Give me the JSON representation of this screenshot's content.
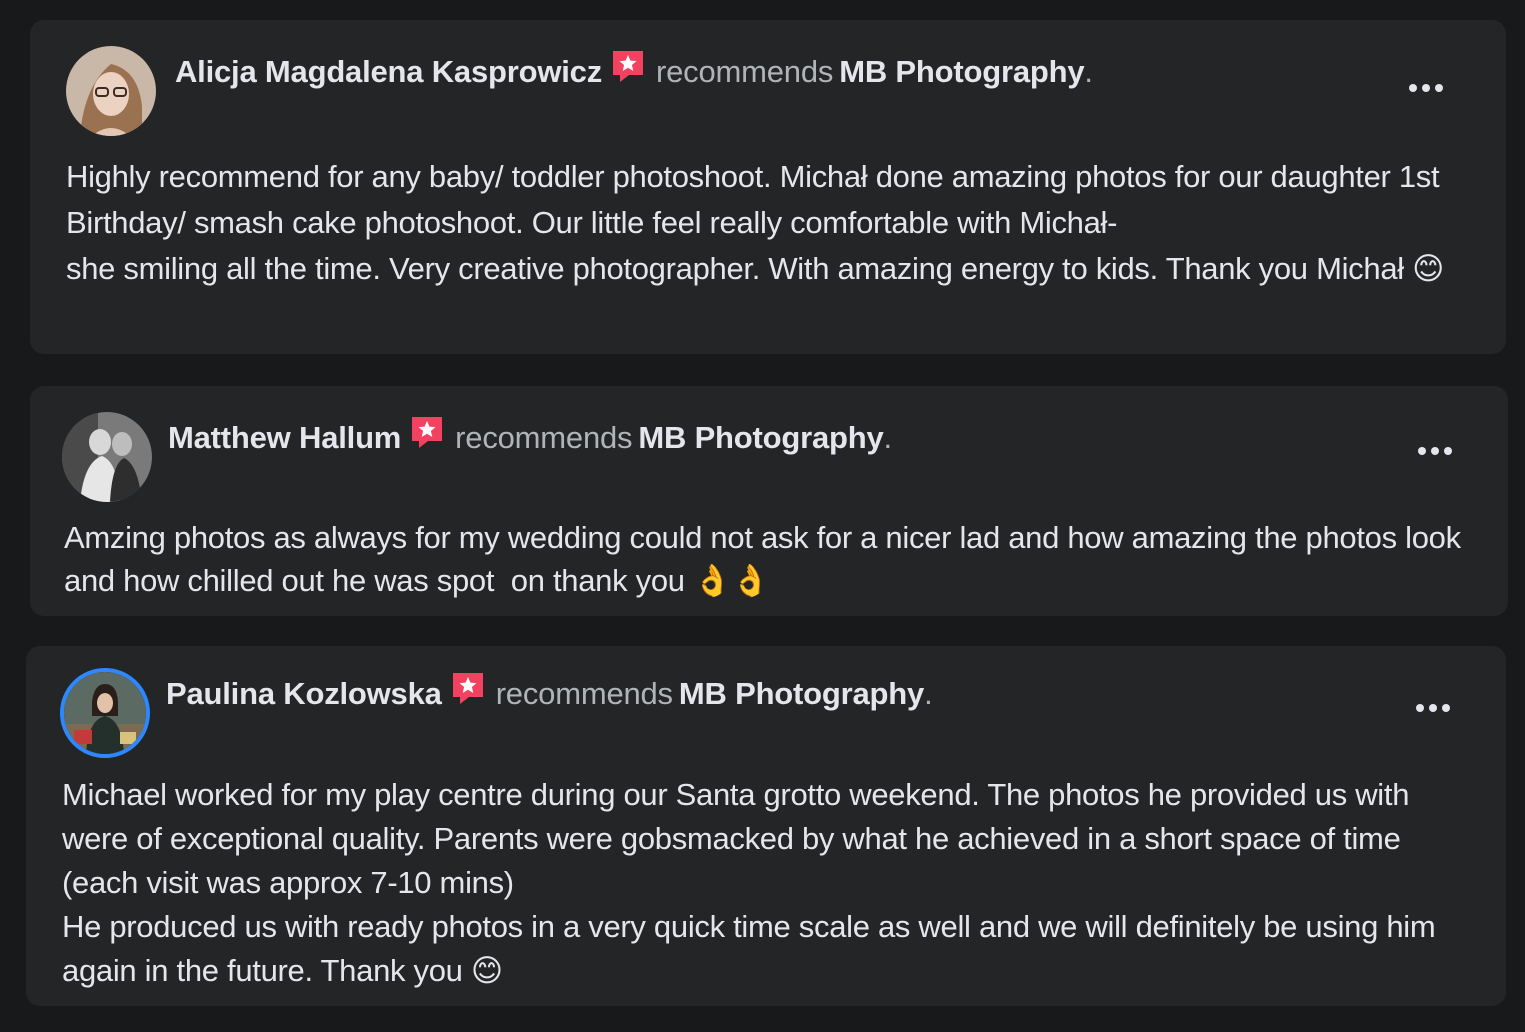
{
  "page_name": "MB Photography",
  "recommends_label": "recommends",
  "period": ".",
  "colors": {
    "background": "#18191a",
    "card": "#242526",
    "primary_text": "#e4e6eb",
    "secondary_text": "#b0b3b8",
    "recommend_badge": "#f3425f",
    "avatar_ring": "#2d88ff"
  },
  "icons": {
    "recommend": "recommendation-star-badge-icon",
    "more": "more-options-icon"
  },
  "reviews": [
    {
      "author": "Alicja Magdalena Kasprowicz",
      "text": "Highly recommend for any baby/ toddler photoshoot. Michał done amazing photos for our daughter 1st Birthday/ smash cake photoshoot. Our little feel really comfortable with Michał-\nshe smiling all the time. Very creative photographer. With amazing energy to kids. Thank you Michał 😊"
    },
    {
      "author": "Matthew Hallum",
      "text": "Amzing photos as always for my wedding could not ask for a nicer lad and how amazing the photos look and how chilled out he was spot  on thank you 👌👌"
    },
    {
      "author": "Paulina Kozlowska",
      "text": "Michael worked for my play centre during our Santa grotto weekend. The photos he provided us with were of exceptional quality. Parents were gobsmacked by what he achieved in a short space of time (each visit was approx 7-10 mins)\nHe produced us with ready photos in a very quick time scale as well and we will definitely be using him again in the future. Thank you 😊"
    }
  ]
}
